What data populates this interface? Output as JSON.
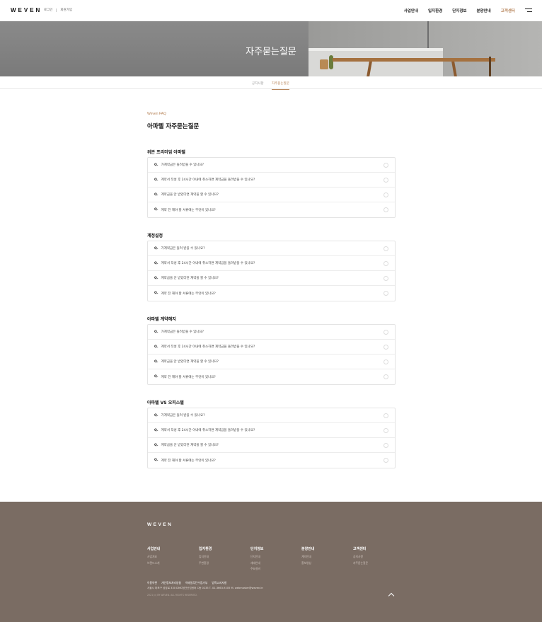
{
  "header": {
    "logo": "WEVEN",
    "util": [
      "로그인",
      "회원가입"
    ],
    "nav": [
      "사업안내",
      "입지환경",
      "단지정보",
      "분양안내",
      "고객센터"
    ],
    "active_nav": "고객센터"
  },
  "hero": {
    "title": "자주묻는질문"
  },
  "subnav": {
    "tabs": [
      "공지사항",
      "자주묻는질문"
    ],
    "active": "자주묻는질문"
  },
  "main": {
    "kicker": "Weven FAQ",
    "title": "아파텔 자주묻는질문",
    "sections": [
      {
        "title": "위븐 프리미엄 아파텔",
        "items": [
          "가계약금은 돌려받을 수 있나요?",
          "계약서 작성 후 24시간 이내에 취소하면 계약금을 돌려받을 수 있나요?",
          "계약금을 안 받았다면 계약을 할 수 있나요?",
          "계약 전 해야 할 서류에는 무엇이 있나요?"
        ]
      },
      {
        "title": "계정설정",
        "items": [
          "가계약금은 돌려 받을 수 있나요?",
          "계약서 작성 후 24시간 이내에 취소하면 계약금을 돌려받을 수 있나요?",
          "계약금을 안 받았다면 계약을 할 수 있나요?",
          "계약 전 해야 할 서류에는 무엇이 있나요?"
        ]
      },
      {
        "title": "아파텔 계약해지",
        "items": [
          "가계약금은 돌려받을 수 있나요?",
          "계약서 작성 후 24시간 이내에 취소하면 계약금을 돌려받을 수 있나요?",
          "계약금을 안 받았다면 계약을 할 수 있나요?",
          "계약 전 해야 할 서류에는 무엇이 있나요?"
        ]
      },
      {
        "title": "아파텔 VS 오피스텔",
        "items": [
          "가계약금은 돌려 받을 수 있나요?",
          "계약서 작성 후 24시간 이내에 취소하면 계약금을 돌려받을 수 있나요?",
          "계약금을 안 받았다면 계약을 할 수 있나요?",
          "계약 전 해야 할 서류에는 무엇이 있나요?"
        ]
      }
    ],
    "q_prefix": "Q."
  },
  "footer": {
    "logo": "WEVEN",
    "columns": [
      {
        "heading": "사업안내",
        "links": [
          "사업개요",
          "브랜드소개"
        ]
      },
      {
        "heading": "입지환경",
        "links": [
          "입지안내",
          "주변환경"
        ]
      },
      {
        "heading": "단지정보",
        "links": [
          "단지안내",
          "세대안내",
          "주요설비"
        ]
      },
      {
        "heading": "분양안내",
        "links": [
          "계약안내",
          "홍보영상"
        ]
      },
      {
        "heading": "고객센터",
        "links": [
          "공지사항",
          "자주묻는질문"
        ]
      }
    ],
    "links": [
      "이용약관",
      "개인정보처리방침",
      "이메일무단수집거부",
      "법적고지사항"
    ],
    "info": "서울시 마포구 성암로 330 DMC첨단산업센터 C동 0235   T. 02-3663-9205   M. webmaster@weven.kr",
    "copyright": "2021 (c) BY WEVEN. ALL RIGHTS RESERVED."
  },
  "colors": {
    "accent": "#b8865c",
    "footer_bg": "#7a6c63"
  }
}
